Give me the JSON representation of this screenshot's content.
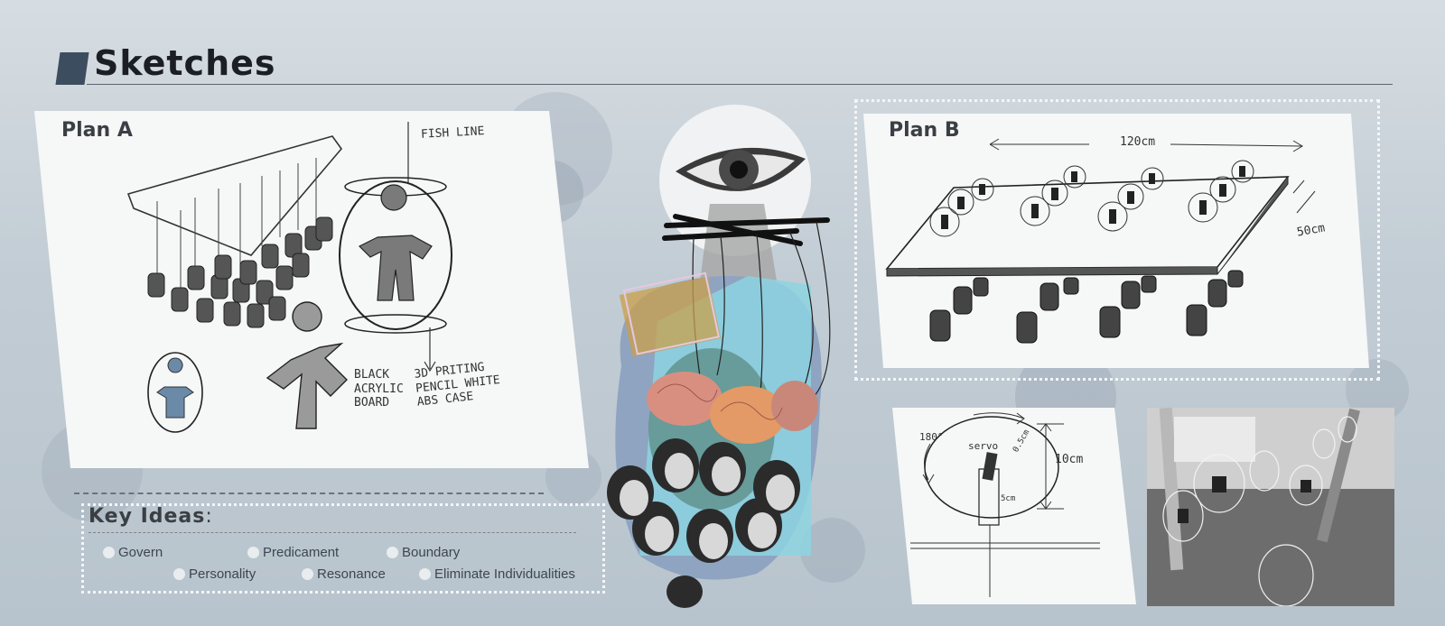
{
  "header": {
    "title": "Sketches"
  },
  "plan_a": {
    "label": "Plan A",
    "annotations": {
      "fish_line": "FISH LINE",
      "material_1": "BLACK ACRYLIC BOARD",
      "material_2": "3D PRITING PENCIL WHITE ABS CASE"
    }
  },
  "plan_b": {
    "label": "Plan B",
    "annotations": {
      "width": "120cm",
      "depth": "50cm"
    }
  },
  "servo_sketch": {
    "annotations": {
      "angle": "180°",
      "label": "servo",
      "height": "10cm",
      "inner": "5cm",
      "radius": "0.5cm"
    }
  },
  "key_ideas": {
    "title": "Key Ideas",
    "colon": ":",
    "items": [
      "Govern",
      "Predicament",
      "Boundary",
      "Personality",
      "Resonance",
      "Eliminate Individualities"
    ]
  },
  "colors": {
    "title_bar": "#3d4d60",
    "panel": "#f6f7f7",
    "background": "#c2ccd4"
  }
}
